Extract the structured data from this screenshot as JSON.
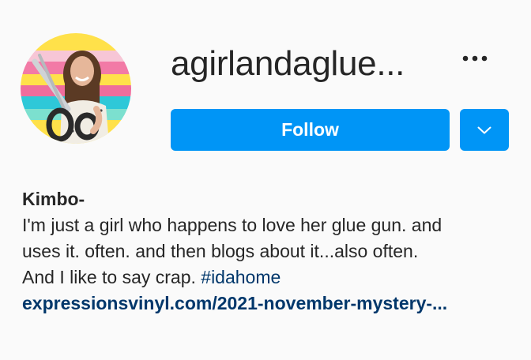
{
  "profile": {
    "username": "agirlandaglue...",
    "display_name": "Kimbo-",
    "bio_line_1": "I'm just a girl who happens to love her glue gun. and",
    "bio_line_2": "uses it. often. and then blogs about it...also often.",
    "bio_line_3": "And I like to say crap. ",
    "hashtag": "#idahome",
    "website": "expressionsvinyl.com/2021-november-mystery-..."
  },
  "actions": {
    "follow_label": "Follow",
    "more_icon": "more-horizontal-icon",
    "dropdown_icon": "chevron-down-icon"
  },
  "colors": {
    "primary_button": "#0095f6",
    "link": "#00376b",
    "text": "#262626",
    "background": "#fafafa"
  }
}
